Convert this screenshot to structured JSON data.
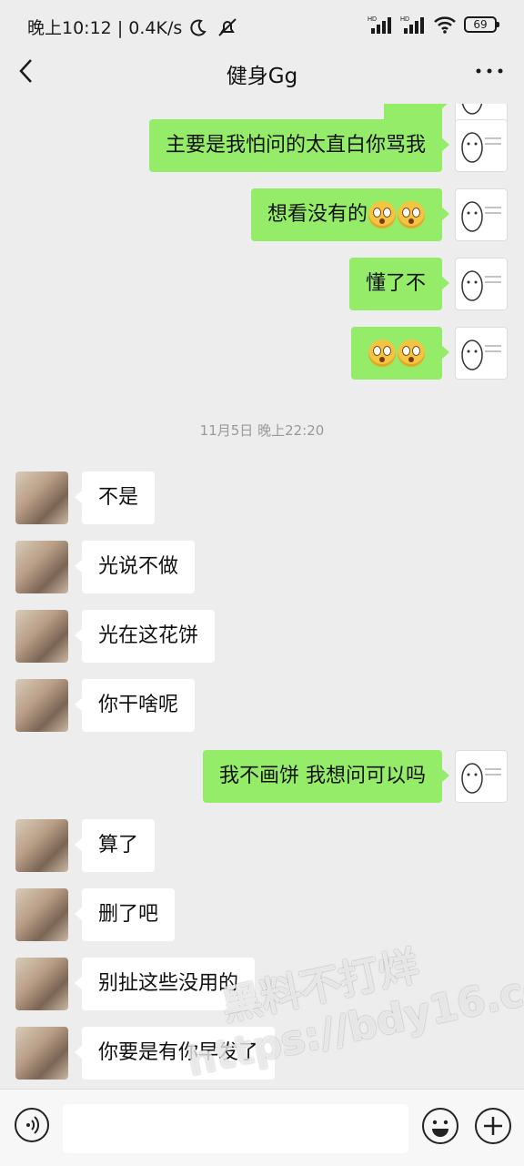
{
  "status_bar": {
    "time": "晚上10:12",
    "net_speed": "0.4K/s",
    "battery": "69",
    "signal_label_1": "HD",
    "signal_label_2": "HD"
  },
  "header": {
    "title": "健身Gg"
  },
  "messages_before": [
    {
      "text": "主要是我怕问的太直白你骂我"
    },
    {
      "text": "想看没有的"
    },
    {
      "text": "懂了不"
    },
    {
      "text": ""
    }
  ],
  "timestamp": "11月5日 晚上22:20",
  "messages_after": [
    {
      "text": "不是"
    },
    {
      "text": "光说不做"
    },
    {
      "text": "光在这花饼"
    },
    {
      "text": "你干啥呢"
    },
    {
      "text": "我不画饼 我想问可以吗"
    },
    {
      "text": "算了"
    },
    {
      "text": "删了吧"
    },
    {
      "text": "别扯这些没用的"
    },
    {
      "text": "你要是有你早发了"
    }
  ],
  "watermark": {
    "line1": "黑料不打烊",
    "line2": "https://bdy16.co"
  },
  "colors": {
    "outgoing_bubble": "#95ec69",
    "incoming_bubble": "#ffffff",
    "background": "#ededed"
  }
}
